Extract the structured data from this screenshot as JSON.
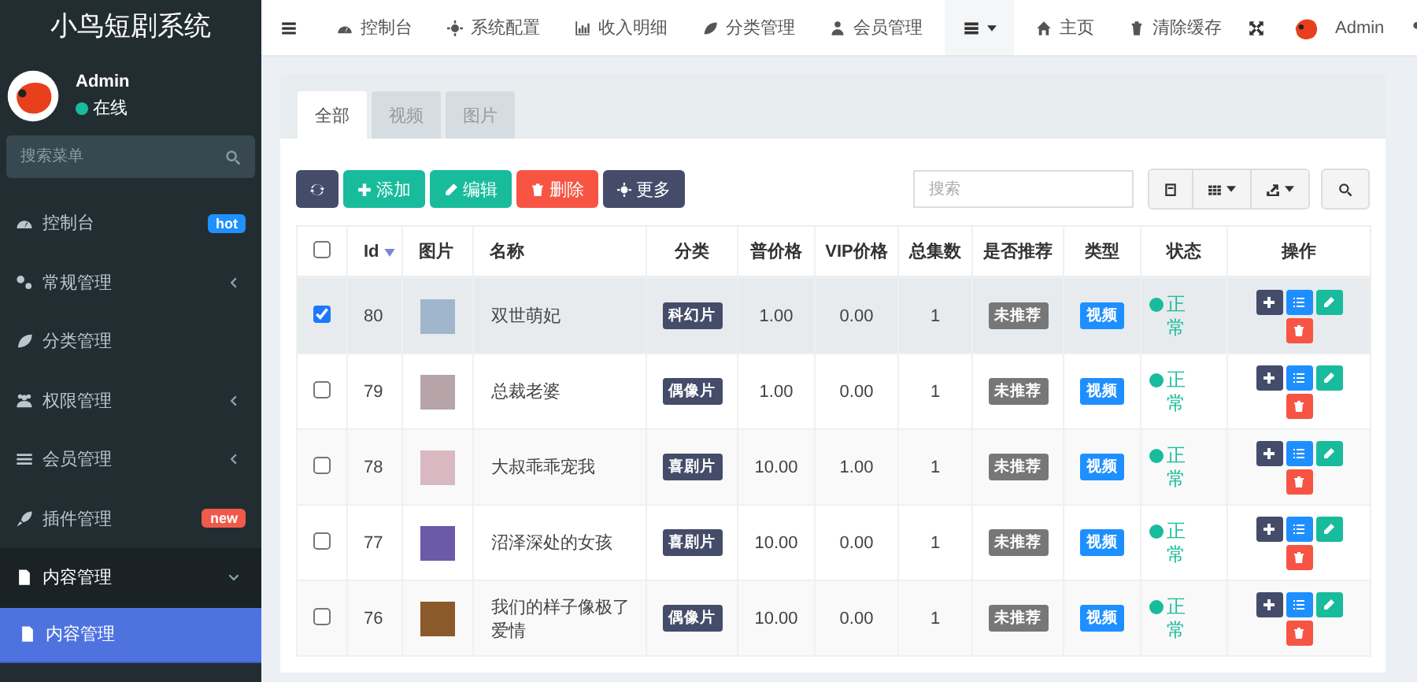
{
  "sidebar": {
    "title": "小鸟短剧系统",
    "user": {
      "name": "Admin",
      "status": "在线"
    },
    "search": {
      "placeholder": "搜索菜单"
    },
    "items": [
      {
        "label": "控制台",
        "selected": false,
        "badge": {
          "text": "hot",
          "color": "#1e90ff"
        }
      },
      {
        "label": "常规管理",
        "selected": false,
        "expanded": false
      },
      {
        "label": "分类管理",
        "selected": false
      },
      {
        "label": "权限管理",
        "selected": false,
        "expanded": false
      },
      {
        "label": "会员管理",
        "selected": false,
        "expanded": false
      },
      {
        "label": "插件管理",
        "selected": false,
        "badge": {
          "text": "new",
          "color": "#f05a4a"
        }
      },
      {
        "label": "内容管理",
        "selected": true,
        "expanded": true,
        "children": [
          {
            "label": "内容管理",
            "selected": true
          }
        ]
      }
    ]
  },
  "navbar": {
    "items": [
      {
        "label": "控制台"
      },
      {
        "label": "系统配置"
      },
      {
        "label": "收入明细"
      },
      {
        "label": "分类管理"
      },
      {
        "label": "会员管理"
      }
    ],
    "right_items": [
      {
        "label": "主页"
      },
      {
        "label": "清除缓存"
      }
    ],
    "user": {
      "name": "Admin"
    }
  },
  "tabs": [
    {
      "label": "全部",
      "selected": true
    },
    {
      "label": "视频",
      "selected": false
    },
    {
      "label": "图片",
      "selected": false
    }
  ],
  "toolbar": [
    {
      "kind": "refresh"
    },
    {
      "kind": "add",
      "label": "添加"
    },
    {
      "kind": "edit",
      "label": "编辑"
    },
    {
      "kind": "delete",
      "label": "删除"
    },
    {
      "kind": "more",
      "label": "更多"
    }
  ],
  "search": {
    "placeholder": "搜索"
  },
  "table": {
    "all_checked": false,
    "columns": [
      {
        "label": "Id",
        "sorted": true
      },
      {
        "label": "图片"
      },
      {
        "label": "名称"
      },
      {
        "label": "分类"
      },
      {
        "label": "普价格"
      },
      {
        "label": "VIP价格"
      },
      {
        "label": "总集数"
      },
      {
        "label": "是否推荐"
      },
      {
        "label": "类型"
      },
      {
        "label": "状态"
      },
      {
        "label": "操作"
      }
    ],
    "rows": [
      {
        "checked": true,
        "id": "80",
        "name": "双世萌妃",
        "category": "科幻片",
        "price": "1.00",
        "vip_price": "0.00",
        "episodes": "1",
        "recommend": "未推荐",
        "type": "视频",
        "status": "正常"
      },
      {
        "checked": false,
        "id": "79",
        "name": "总裁老婆",
        "category": "偶像片",
        "price": "1.00",
        "vip_price": "0.00",
        "episodes": "1",
        "recommend": "未推荐",
        "type": "视频",
        "status": "正常"
      },
      {
        "checked": false,
        "id": "78",
        "name": "大叔乖乖宠我",
        "category": "喜剧片",
        "price": "10.00",
        "vip_price": "1.00",
        "episodes": "1",
        "recommend": "未推荐",
        "type": "视频",
        "status": "正常"
      },
      {
        "checked": false,
        "id": "77",
        "name": "沼泽深处的女孩",
        "category": "喜剧片",
        "price": "10.00",
        "vip_price": "0.00",
        "episodes": "1",
        "recommend": "未推荐",
        "type": "视频",
        "status": "正常"
      },
      {
        "checked": false,
        "id": "76",
        "name": "我们的样子像极了爱情",
        "category": "偶像片",
        "price": "10.00",
        "vip_price": "0.00",
        "episodes": "1",
        "recommend": "未推荐",
        "type": "视频",
        "status": "正常"
      }
    ]
  }
}
